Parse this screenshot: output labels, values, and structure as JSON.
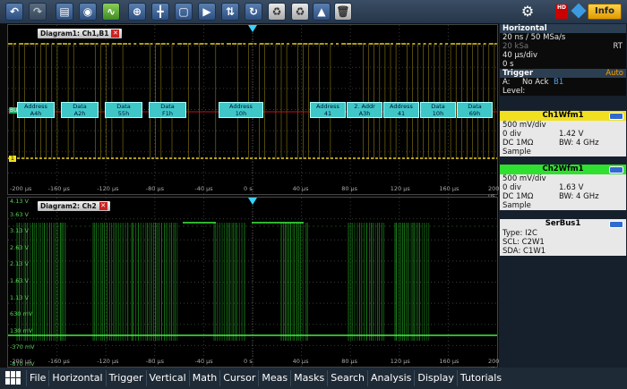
{
  "toolbar": {
    "buttons": [
      "back-icon",
      "forward-icon",
      "open-folder-icon",
      "camera-icon",
      "autoset-icon",
      "zoom-icon",
      "cursor-icon",
      "fft-icon",
      "marker-icon",
      "pulse-icon",
      "history-icon",
      "mask-icon",
      "mask-test-icon",
      "network-icon",
      "delete-icon"
    ],
    "info_label": "Info",
    "hd_label": "HD"
  },
  "diagram1": {
    "tab_label": "Diagram1: Ch1,B1",
    "bus_label": "BUS 1:I2C",
    "marker_label": "1",
    "x_ticks": [
      "-200 µs",
      "-160 µs",
      "-120 µs",
      "-80 µs",
      "-40 µs",
      "0 s",
      "40 µs",
      "80 µs",
      "120 µs",
      "160 µs",
      "200 µs"
    ],
    "frames_left": [
      {
        "top": "Address",
        "bottom": "A4h"
      },
      {
        "top": "Data",
        "bottom": "A2h"
      },
      {
        "top": "Data",
        "bottom": "55h"
      },
      {
        "top": "Data",
        "bottom": "F1h"
      }
    ],
    "frame_center": {
      "top": "Address",
      "bottom": "10h"
    },
    "frames_right": [
      {
        "top": "Address",
        "bottom": "41"
      },
      {
        "top": "2. Addr",
        "bottom": "A3h"
      },
      {
        "top": "Address",
        "bottom": "41"
      },
      {
        "top": "Data",
        "bottom": "10h"
      },
      {
        "top": "Data",
        "bottom": "69h"
      }
    ]
  },
  "diagram2": {
    "tab_label": "Diagram2: Ch2",
    "y_ticks": [
      "4.13 V",
      "3.63 V",
      "3.13 V",
      "2.63 V",
      "2.13 V",
      "1.63 V",
      "1.13 V",
      "630 mV",
      "130 mV",
      "-370 mV",
      "-870 mV"
    ],
    "x_ticks": [
      "-200 µs",
      "-160 µs",
      "-120 µs",
      "-80 µs",
      "-40 µs",
      "0 s",
      "40 µs",
      "80 µs",
      "120 µs",
      "160 µs",
      "200 µs"
    ]
  },
  "horizontal": {
    "title": "Horizontal",
    "line1": "20 ns / 50 MSa/s",
    "line2": "20 kSa",
    "line2_right": "RT",
    "line3": "40 µs/div",
    "line4": "0 s"
  },
  "trigger": {
    "title": "Trigger",
    "mode": "Auto",
    "source": "A:",
    "condition": "No Ack",
    "bus": "B1",
    "level_label": "Level:"
  },
  "ch1": {
    "title": "Ch1Wfm1",
    "scale": "500 mV/div",
    "position_label": "0 div",
    "position_value": "1.42 V",
    "coupling": "DC 1MΩ",
    "bandwidth": "BW: 4 GHz",
    "mode": "Sample",
    "color": "#f0e020"
  },
  "ch2": {
    "title": "Ch2Wfm1",
    "scale": "500 mV/div",
    "position_label": "0 div",
    "position_value": "1.63 V",
    "coupling": "DC 1MΩ",
    "bandwidth": "BW: 4 GHz",
    "mode": "Sample",
    "color": "#30e030"
  },
  "serbus": {
    "title": "SerBus1",
    "type": "Type: I2C",
    "scl": "SCL: C2W1",
    "sda": "SDA: C1W1"
  },
  "menu": [
    "File",
    "Horizontal",
    "Trigger",
    "Vertical",
    "Math",
    "Cursor",
    "Meas",
    "Masks",
    "Search",
    "Analysis",
    "Display",
    "Tutorials"
  ]
}
